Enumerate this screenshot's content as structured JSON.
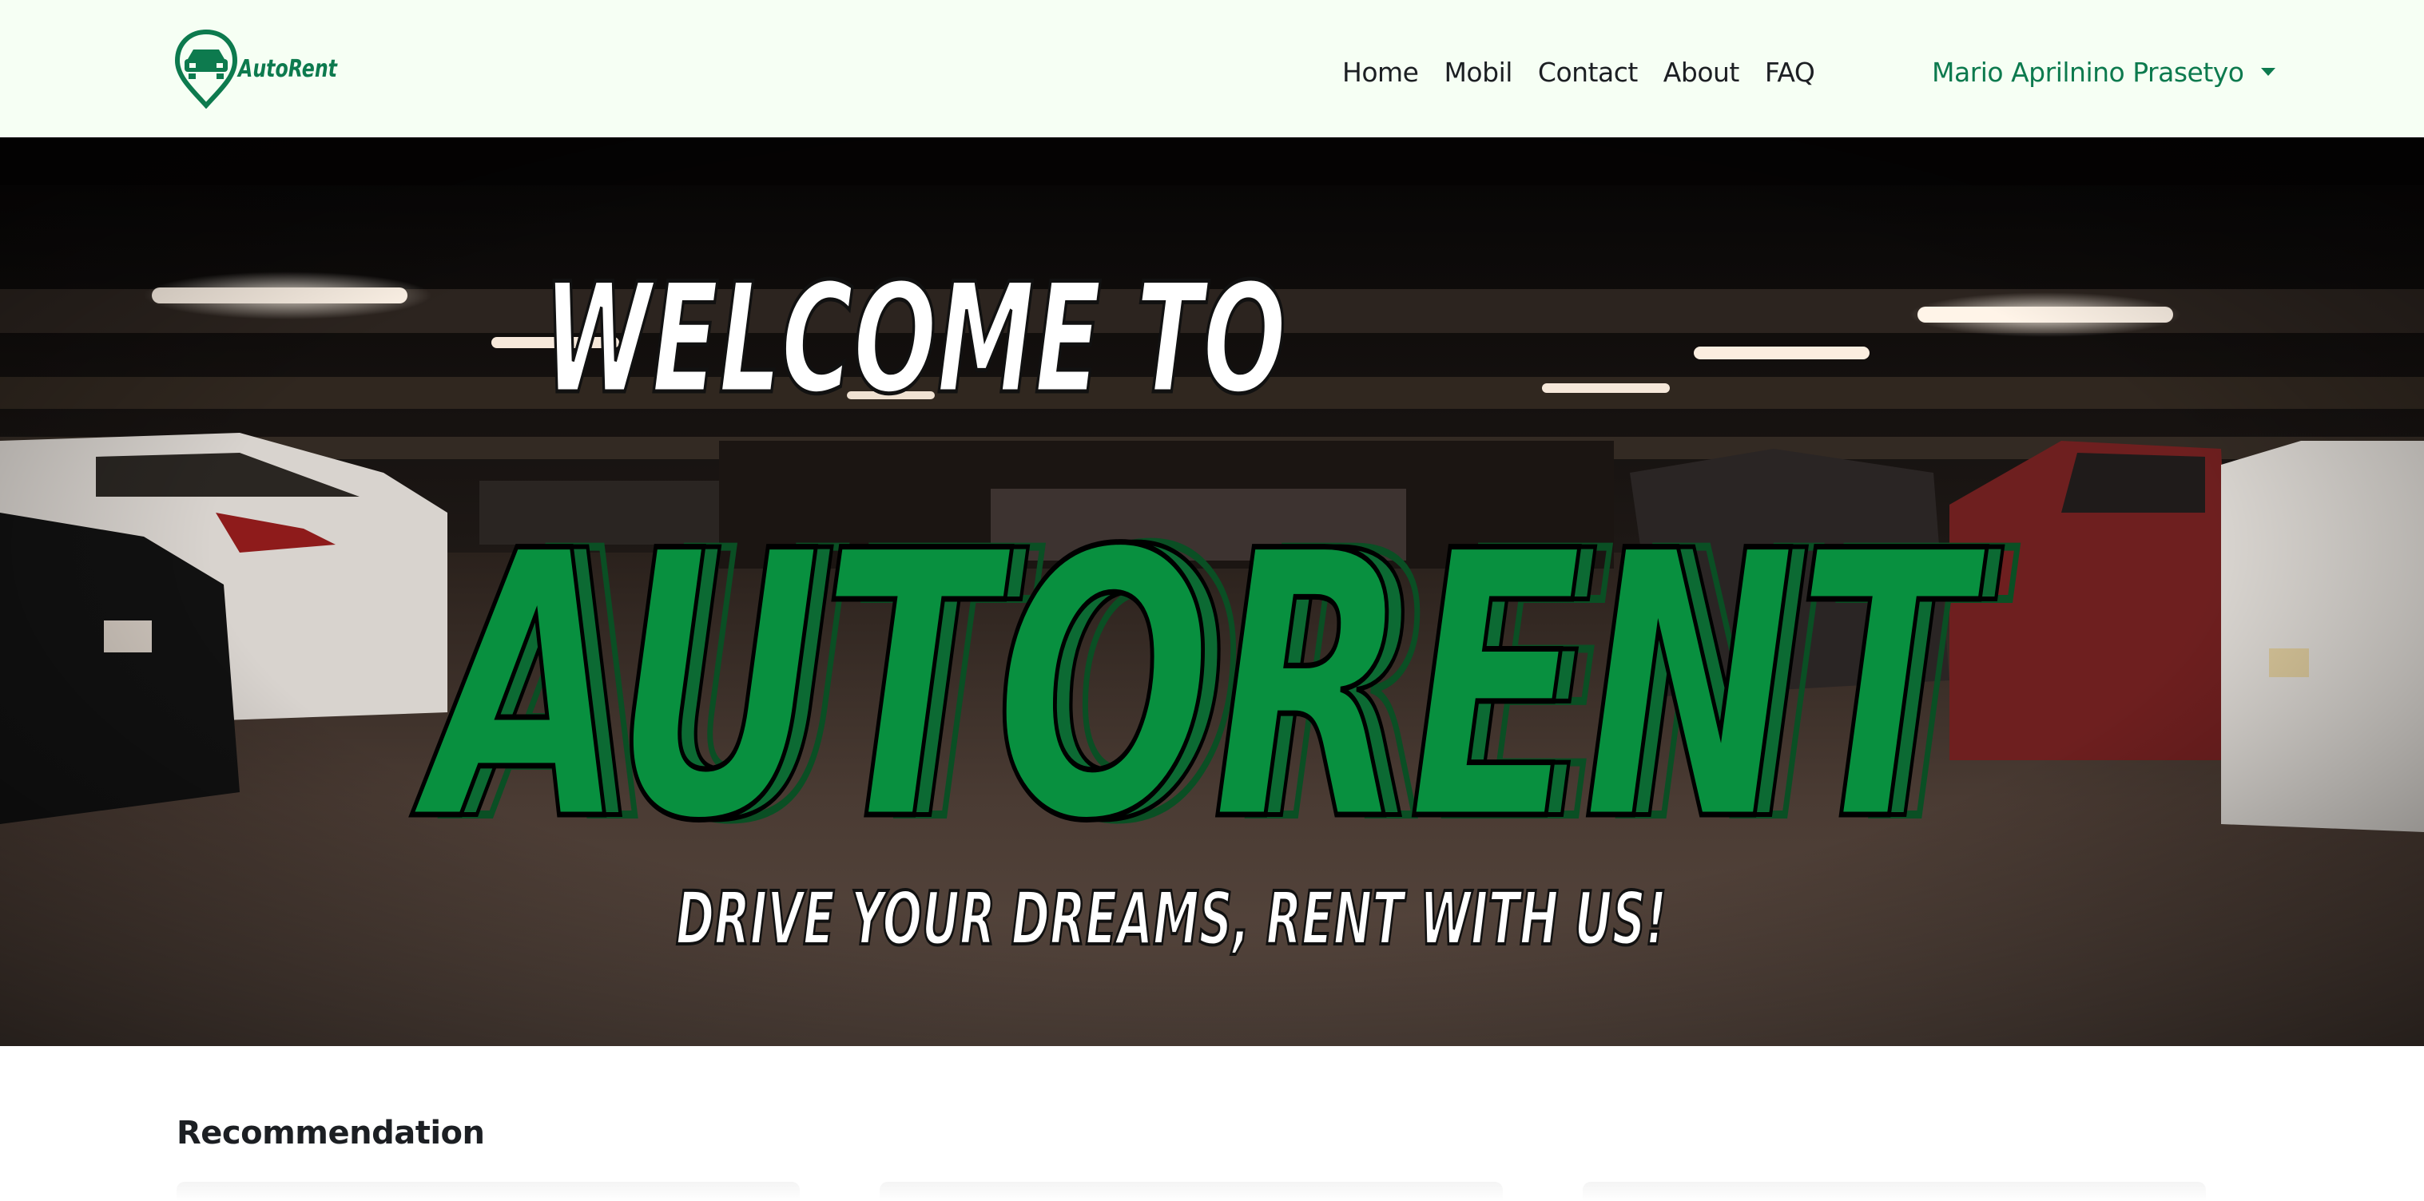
{
  "navbar": {
    "brand_text": "AutoRent",
    "links": [
      "Home",
      "Mobil",
      "Contact",
      "About",
      "FAQ"
    ],
    "user_name": "Mario Aprilnino Prasetyo"
  },
  "hero": {
    "line1": "WELCOME TO",
    "line2": "AUTORENT",
    "tagline": "DRIVE YOUR DREAMS, RENT WITH US!"
  },
  "recommendation": {
    "title": "Recommendation"
  },
  "colors": {
    "brand_green": "#0d7a4e",
    "hero_green": "#08903f",
    "nav_bg": "#f6fff4",
    "text_dark": "#1c1f23"
  },
  "icons": {
    "brand_logo": "car-location-pin-icon",
    "user_menu": "caret-down-icon"
  }
}
